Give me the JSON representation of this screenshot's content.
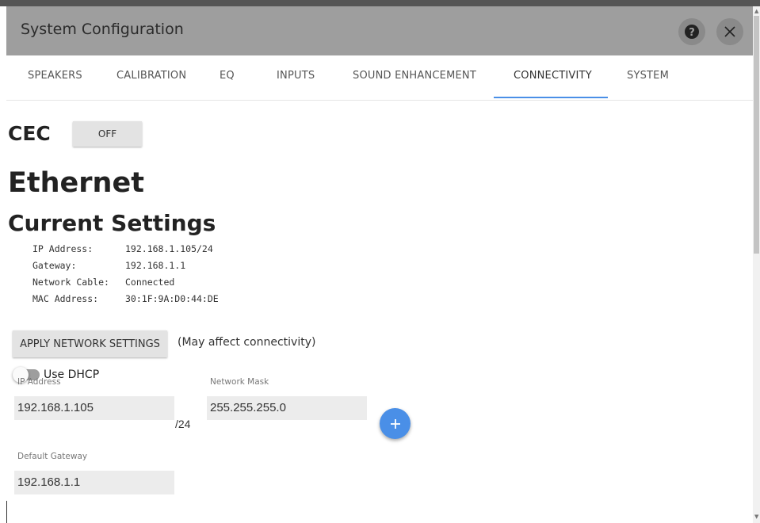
{
  "dialog": {
    "title": "System Configuration",
    "help_icon": "question-mark-circle",
    "close_icon": "close-x"
  },
  "tabs": [
    {
      "label": "SPEAKERS"
    },
    {
      "label": "CALIBRATION"
    },
    {
      "label": "EQ"
    },
    {
      "label": "INPUTS"
    },
    {
      "label": "SOUND ENHANCEMENT"
    },
    {
      "label": "CONNECTIVITY",
      "active": true
    },
    {
      "label": "SYSTEM"
    }
  ],
  "cec": {
    "heading": "CEC",
    "button_label": "OFF"
  },
  "ethernet": {
    "heading": "Ethernet",
    "current_heading": "Current Settings",
    "current": [
      {
        "label": "IP Address:",
        "value": "192.168.1.105/24"
      },
      {
        "label": "Gateway:",
        "value": "192.168.1.1"
      },
      {
        "label": "Network Cable:",
        "value": "Connected"
      },
      {
        "label": "MAC Address:",
        "value": "30:1F:9A:D0:44:DE"
      }
    ],
    "apply_button": "APPLY NETWORK SETTINGS",
    "apply_note": "(May affect connectivity)",
    "dhcp_label": "Use DHCP",
    "dhcp_enabled": false,
    "ip_label": "IP Address",
    "ip_value": "192.168.1.105",
    "prefix": "/24",
    "mask_label": "Network Mask",
    "mask_value": "255.255.255.0",
    "add_icon": "plus",
    "gateway_label": "Default Gateway",
    "gateway_value": "192.168.1.1"
  },
  "colors": {
    "accent": "#4a8fe7",
    "titlebar": "#9e9e9e"
  }
}
